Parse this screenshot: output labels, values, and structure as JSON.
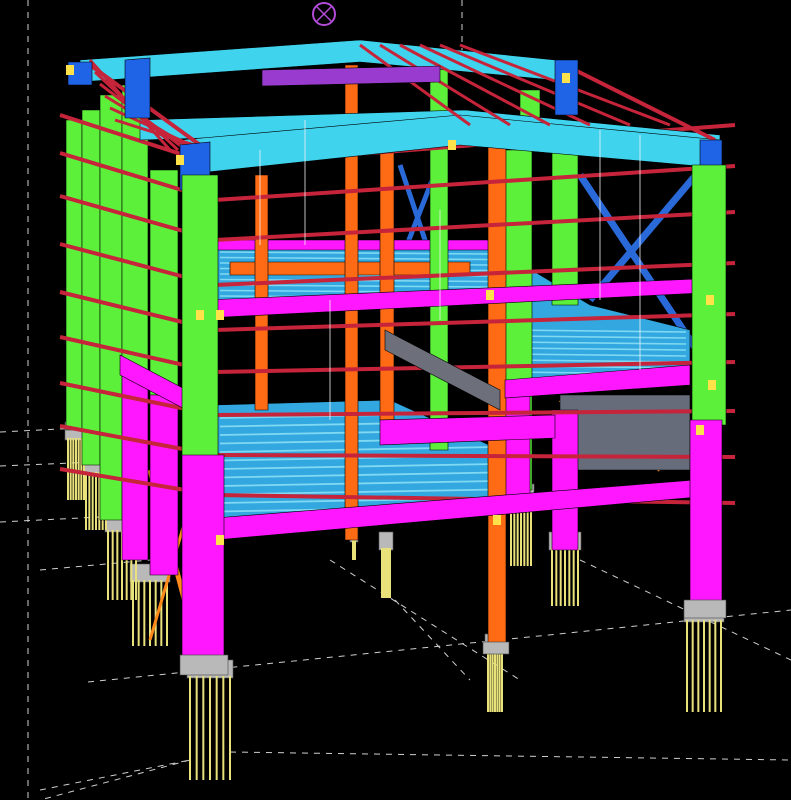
{
  "view": {
    "description_hidden": "",
    "background_color": "#000000",
    "grid_color": "#cfcfcf",
    "compass_color": "#b24bd6"
  },
  "palette": {
    "column_green": "#5cf03a",
    "column_magenta": "#ff18ff",
    "column_orange": "#ff6a14",
    "rafter_cyan": "#3fd3ee",
    "rafter_blue": "#1f63e6",
    "girt_red": "#c6243a",
    "deck_blue": "#33a8e0",
    "deck_stripe": "#7fd9f2",
    "brace_blue": "#2a6ad8",
    "brace_orange": "#ff8a1a",
    "pile_yellow": "#e9e27a",
    "footing_grey": "#b9b9b9",
    "bolt_yellow": "#ffe24a",
    "wire_white": "#f2f2f2"
  },
  "labels": {
    "grid_ticks": [
      "",
      "",
      "",
      ""
    ]
  }
}
